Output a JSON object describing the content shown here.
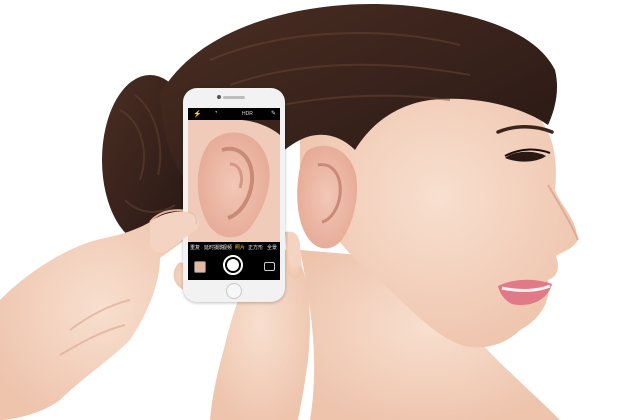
{
  "scene": {
    "description_free": true,
    "background_color": "#ffffff",
    "skin_color": "#f4d3c2",
    "hair_color": "#3b241c",
    "lip_color": "#e07a86"
  },
  "phone": {
    "body_color": "#f2f2f2",
    "accent_color": "#f3c24a",
    "top_bar": {
      "flash_icon": "flash-icon",
      "timer_icon": "timer-icon",
      "hdr_label": "HDR",
      "filter_icon": "filter-icon"
    },
    "camera_modes": [
      "重复",
      "延时摄影",
      "视频",
      "照片",
      "正方形",
      "全景"
    ],
    "active_mode_index": 3,
    "shutter_icon": "shutter-icon",
    "gallery_icon": "gallery-thumbnail-icon",
    "home_icon": "home-button-icon"
  }
}
